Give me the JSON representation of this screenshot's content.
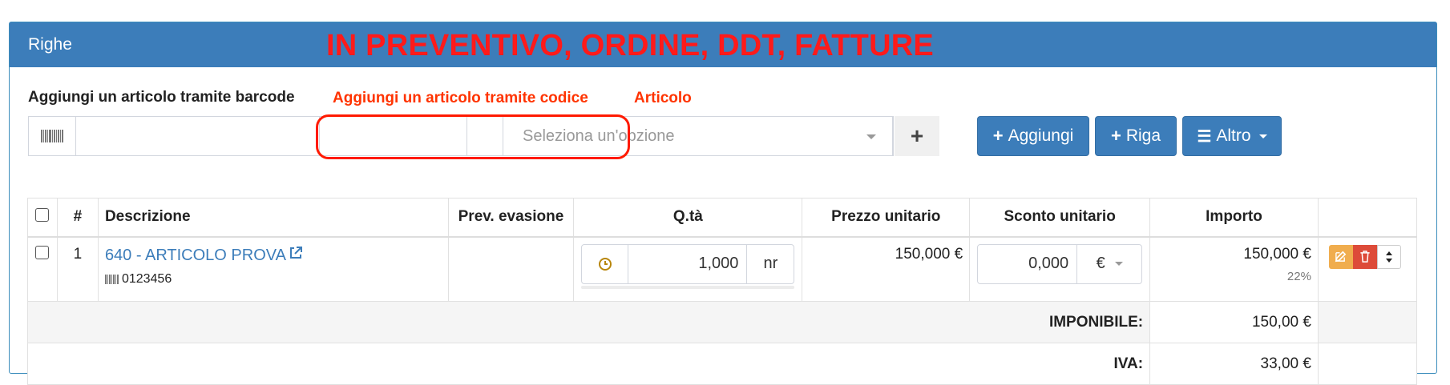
{
  "panel": {
    "title": "Righe",
    "annotation_main": "IN PREVENTIVO, ORDINE, DDT, FATTURE"
  },
  "form": {
    "barcode_label": "Aggiungi un articolo tramite barcode",
    "annotation_codice": "Aggiungi un articolo tramite codice",
    "annotation_articolo": "Articolo",
    "barcode_value": "",
    "codice_value": "",
    "select_placeholder": "Seleziona un'opzione",
    "plus_label": "+"
  },
  "buttons": {
    "aggiungi": "Aggiungi",
    "riga": "Riga",
    "altro": "Altro",
    "plus_glyph": "+",
    "list_glyph": "☰"
  },
  "table": {
    "headers": {
      "num": "#",
      "descrizione": "Descrizione",
      "prev_evasione": "Prev. evasione",
      "qta": "Q.tà",
      "prezzo_unitario": "Prezzo unitario",
      "sconto_unitario": "Sconto unitario",
      "importo": "Importo"
    },
    "rows": [
      {
        "num": "1",
        "descrizione": "640 - ARTICOLO PROVA",
        "barcode": "0123456",
        "prev_evasione": "",
        "qta": "1,000",
        "unita": "nr",
        "prezzo_unitario": "150,000 €",
        "sconto": "0,000",
        "sconto_tipo": "€",
        "importo": "150,000 €",
        "iva": "22%"
      }
    ],
    "totals": {
      "imponibile_label": "IMPONIBILE:",
      "imponibile_value": "150,00 €",
      "iva_label": "IVA:",
      "iva_value": "33,00 €"
    }
  },
  "colors": {
    "primary": "#3c7dba",
    "annotation": "#ff1a1a",
    "edit": "#f0ad4e",
    "delete": "#dd4b39"
  },
  "icons": {
    "barcode": "barcode-icon",
    "clock": "clock-icon",
    "external": "external-link-icon",
    "edit": "edit-icon",
    "trash": "trash-icon",
    "sort": "sort-icon"
  }
}
